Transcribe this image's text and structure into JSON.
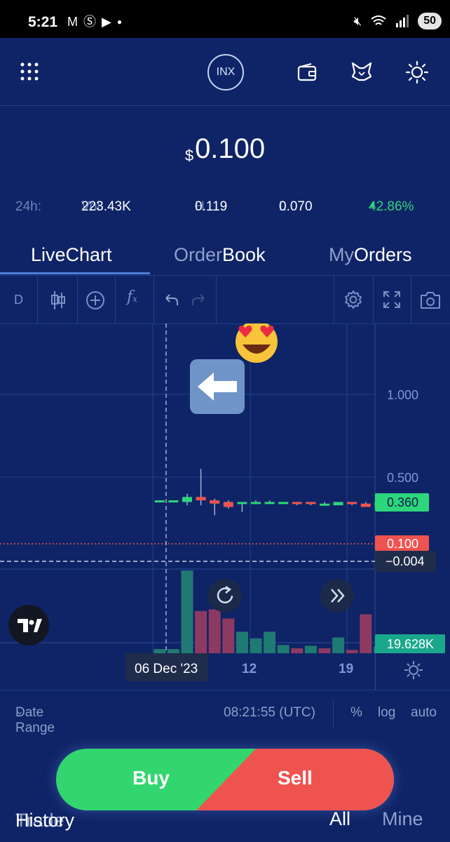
{
  "status_bar": {
    "time": "5:21",
    "battery": "50",
    "notif_icons": [
      "gmail-icon",
      "s-icon",
      "youtube-icon",
      "dot-icon"
    ]
  },
  "app": {
    "logo_text": "INX"
  },
  "price": {
    "currency": "$",
    "value": "0.100"
  },
  "stats": {
    "period": "24h:",
    "vol_label": "Vol",
    "vol_value": "223.43K",
    "high_label": "H",
    "high_value": "0.119",
    "low_label": "L",
    "low_value": "0.070",
    "change": "42.86%"
  },
  "tabs": [
    {
      "pre": "Live",
      "main": "Chart"
    },
    {
      "pre": "Order",
      "main": "Book"
    },
    {
      "pre": "My",
      "main": "Orders"
    }
  ],
  "toolbar": {
    "interval": "D"
  },
  "chart_data": {
    "type": "candlestick",
    "y_ticks": [
      "1.000",
      "0.500"
    ],
    "x_ticks": [
      "06 Dec '23",
      "12",
      "19"
    ],
    "labels": {
      "last_price": "0.360",
      "price_line": "0.100",
      "crosshair": "−0.004",
      "volume": "19.628K"
    },
    "colors": {
      "up": "#2ed67b",
      "down": "#ef5350",
      "vol_up": "#1f7a73",
      "vol_down": "#8d3a63",
      "price_line": "#ef5350"
    },
    "candles": [
      {
        "o": 0.36,
        "h": 0.36,
        "l": 0.36,
        "c": 0.36
      },
      {
        "o": 0.36,
        "h": 0.36,
        "l": 0.36,
        "c": 0.36
      },
      {
        "o": 0.35,
        "h": 0.4,
        "l": 0.33,
        "c": 0.38
      },
      {
        "o": 0.38,
        "h": 0.55,
        "l": 0.33,
        "c": 0.36
      },
      {
        "o": 0.36,
        "h": 0.37,
        "l": 0.27,
        "c": 0.34
      },
      {
        "o": 0.35,
        "h": 0.36,
        "l": 0.31,
        "c": 0.32
      },
      {
        "o": 0.34,
        "h": 0.35,
        "l": 0.29,
        "c": 0.35
      },
      {
        "o": 0.35,
        "h": 0.36,
        "l": 0.34,
        "c": 0.35
      },
      {
        "o": 0.35,
        "h": 0.36,
        "l": 0.34,
        "c": 0.35
      },
      {
        "o": 0.35,
        "h": 0.35,
        "l": 0.34,
        "c": 0.35
      },
      {
        "o": 0.35,
        "h": 0.35,
        "l": 0.33,
        "c": 0.34
      },
      {
        "o": 0.35,
        "h": 0.35,
        "l": 0.33,
        "c": 0.34
      },
      {
        "o": 0.34,
        "h": 0.35,
        "l": 0.33,
        "c": 0.34
      },
      {
        "o": 0.33,
        "h": 0.35,
        "l": 0.33,
        "c": 0.35
      },
      {
        "o": 0.35,
        "h": 0.35,
        "l": 0.33,
        "c": 0.34
      },
      {
        "o": 0.34,
        "h": 0.35,
        "l": 0.32,
        "c": 0.32
      },
      {
        "o": 0.32,
        "h": 0.35,
        "l": 0.32,
        "c": 0.35
      },
      {
        "o": 0.35,
        "h": 0.36,
        "l": 0.35,
        "c": 0.36
      },
      {
        "o": 0.36,
        "h": 0.36,
        "l": 0.36,
        "c": 0.36
      }
    ],
    "volumes": [
      {
        "v": 0.05,
        "up": true
      },
      {
        "v": 0.05,
        "up": true
      },
      {
        "v": 1.0,
        "up": true
      },
      {
        "v": 0.51,
        "up": false
      },
      {
        "v": 0.53,
        "up": false
      },
      {
        "v": 0.42,
        "up": false
      },
      {
        "v": 0.26,
        "up": true
      },
      {
        "v": 0.18,
        "up": true
      },
      {
        "v": 0.26,
        "up": true
      },
      {
        "v": 0.1,
        "up": true
      },
      {
        "v": 0.06,
        "up": false
      },
      {
        "v": 0.09,
        "up": true
      },
      {
        "v": 0.06,
        "up": false
      },
      {
        "v": 0.19,
        "up": true
      },
      {
        "v": 0.04,
        "up": false
      },
      {
        "v": 0.47,
        "up": false
      },
      {
        "v": 0.08,
        "up": true
      },
      {
        "v": 0.21,
        "up": true
      },
      {
        "v": 0.12,
        "up": true
      }
    ]
  },
  "chart_footer": {
    "date_range": "Date Range",
    "time": "08:21:55 (UTC)",
    "pct": "%",
    "log": "log",
    "auto": "auto"
  },
  "actions": {
    "buy": "Buy",
    "sell": "Sell"
  },
  "trade_history": {
    "pre": "Trade",
    "main": "History",
    "all": "All",
    "mine": "Mine"
  }
}
